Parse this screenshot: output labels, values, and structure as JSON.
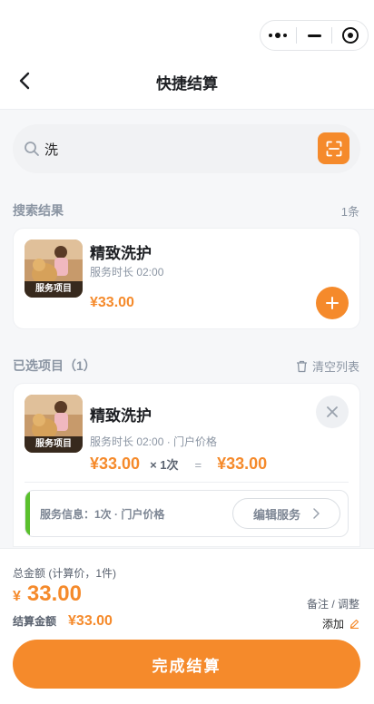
{
  "header": {
    "title": "快捷结算"
  },
  "search": {
    "query": "洗"
  },
  "results": {
    "title": "搜索结果",
    "count": "1条",
    "items": [
      {
        "name": "精致洗护",
        "duration": "服务时长 02:00",
        "price": "¥33.00",
        "image_tag": "服务项目"
      }
    ]
  },
  "selected": {
    "title": "已选项目（1）",
    "clear_label": "清空列表",
    "items": [
      {
        "name": "精致洗护",
        "meta": "服务时长 02:00 · 门户价格",
        "unit_price": "¥33.00",
        "qty": "× 1次",
        "eq": "=",
        "subtotal": "¥33.00",
        "image_tag": "服务项目",
        "info": "服务信息：1次 · 门户价格",
        "edit_label": "编辑服务"
      }
    ]
  },
  "footer": {
    "total_label": "总金额 (计算价，1件)",
    "currency": "¥",
    "total": "33.00",
    "settle_label": "结算金额",
    "settle_value": "¥33.00",
    "note_label": "备注 / 调整",
    "add_label": "添加",
    "submit_label": "完成结算"
  },
  "colors": {
    "accent": "#f58a2b",
    "info_bar": "#5ac02d",
    "muted": "#8b95a3"
  },
  "icons": [
    "more-dots-icon",
    "minimize-icon",
    "target-icon",
    "back-arrow-icon",
    "search-icon",
    "scan-icon",
    "plus-icon",
    "trash-icon",
    "close-icon",
    "chevron-right-icon",
    "pencil-icon"
  ]
}
